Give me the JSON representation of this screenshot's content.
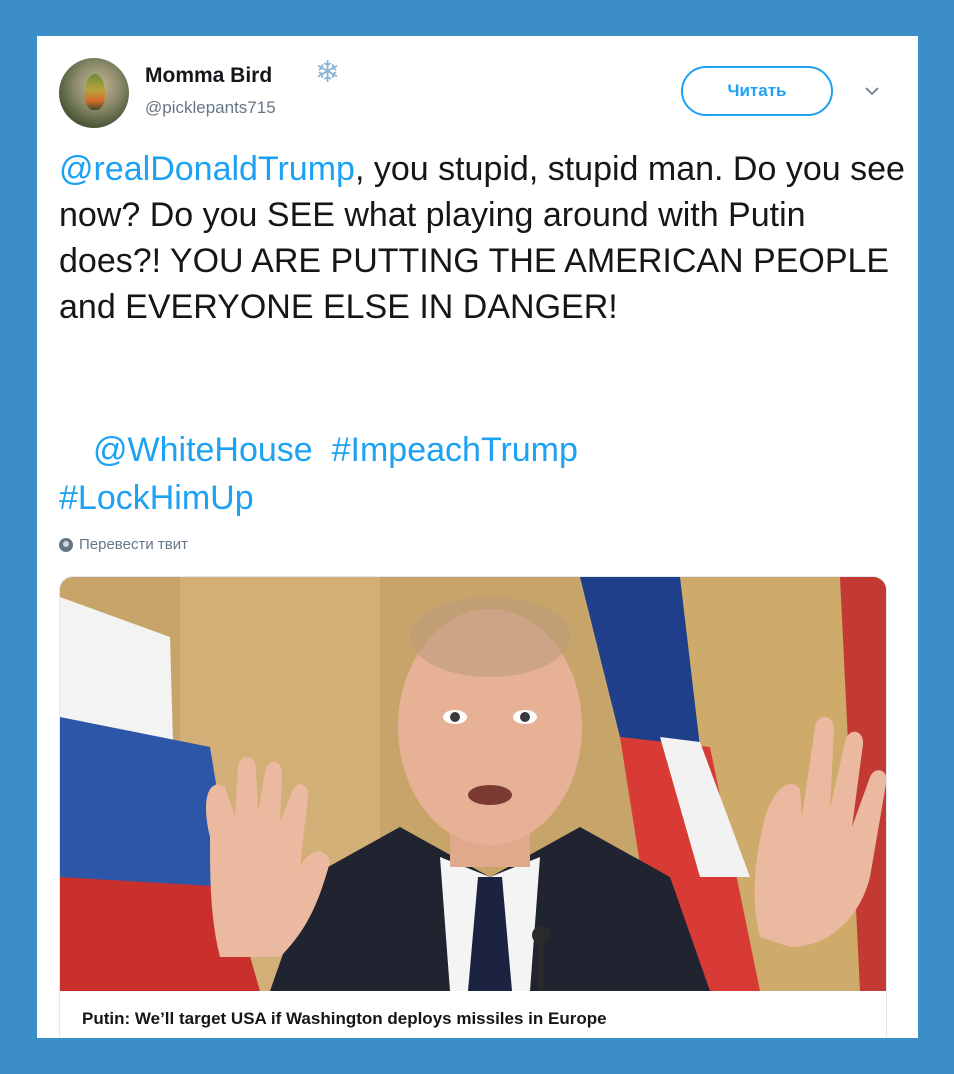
{
  "user": {
    "name": "Momma Bird",
    "badge_icon": "snowflake-icon",
    "handle": "@picklepants715"
  },
  "header": {
    "follow_label": "Читать",
    "menu_icon": "chevron-down-icon"
  },
  "tweet": {
    "mention": "@realDonaldTrump",
    "body": ", you stupid, stupid man. Do you see now? Do you SEE what playing around with Putin does?! YOU ARE PUTTING THE AMERICAN PEOPLE and EVERYONE ELSE IN DANGER!",
    "tag_whitehouse": "@WhiteHouse",
    "tag_impeach": "#ImpeachTrump",
    "tag_lock": "#LockHimUp",
    "translate_label": "Перевести твит"
  },
  "card": {
    "image_subject": "man in dark suit gesturing with both hands raised, flags in background",
    "title": "Putin: We’ll target USA if Washington deploys missiles in Europe"
  },
  "colors": {
    "frame": "#3b8fc6",
    "link": "#1da1f2",
    "text": "#14171a",
    "muted": "#657786"
  }
}
